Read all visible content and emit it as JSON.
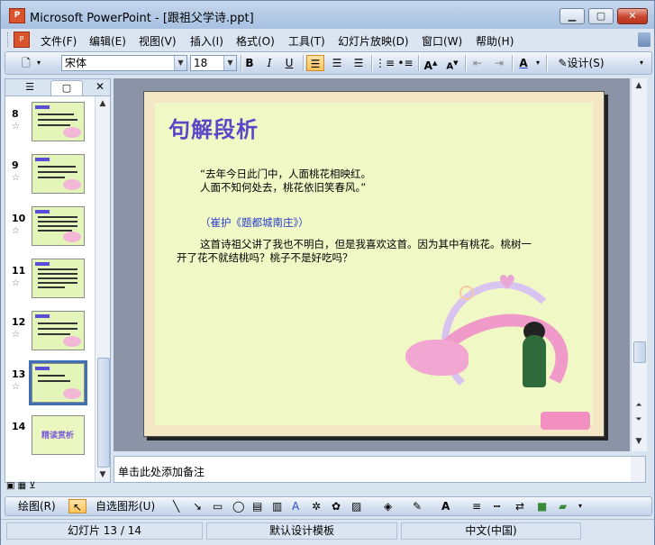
{
  "window": {
    "title": "Microsoft PowerPoint - [跟祖父学诗.ppt]",
    "app_icon": "P"
  },
  "menu": {
    "items": [
      "文件(F)",
      "编辑(E)",
      "视图(V)",
      "插入(I)",
      "格式(O)",
      "工具(T)",
      "幻灯片放映(D)",
      "窗口(W)",
      "帮助(H)"
    ]
  },
  "toolbar": {
    "font_name": "宋体",
    "font_size": "18",
    "bold": "B",
    "italic": "I",
    "underline": "U",
    "design_label": "设计(S)"
  },
  "outline": {
    "slides": [
      {
        "num": "8"
      },
      {
        "num": "9"
      },
      {
        "num": "10"
      },
      {
        "num": "11"
      },
      {
        "num": "12"
      },
      {
        "num": "13"
      },
      {
        "num": "14"
      }
    ],
    "thumb14_title": "精读赏析"
  },
  "slide": {
    "title": "句解段析",
    "poem_line1": "“去年今日此门中，人面桃花相映红。",
    "poem_line2": "人面不知何处去，桃花依旧笑春风。”",
    "source": "（崔护《题都城南庄》）",
    "para_line1": "这首诗祖父讲了我也不明白，但是我喜欢这首。因为其中有桃花。桃树一",
    "para_line2": "开了花不就结桃吗？桃子不是好吃吗？"
  },
  "notes": {
    "placeholder": "单击此处添加备注"
  },
  "drawbar": {
    "draw": "绘图(R)",
    "autoshapes": "自选图形(U)"
  },
  "status": {
    "slide": "幻灯片 13 / 14",
    "template": "默认设计模板",
    "language": "中文(中国)"
  },
  "colors": {
    "title": "#5b45c8",
    "slide_bg": "#f0f9c6",
    "source": "#2a3dcc"
  }
}
